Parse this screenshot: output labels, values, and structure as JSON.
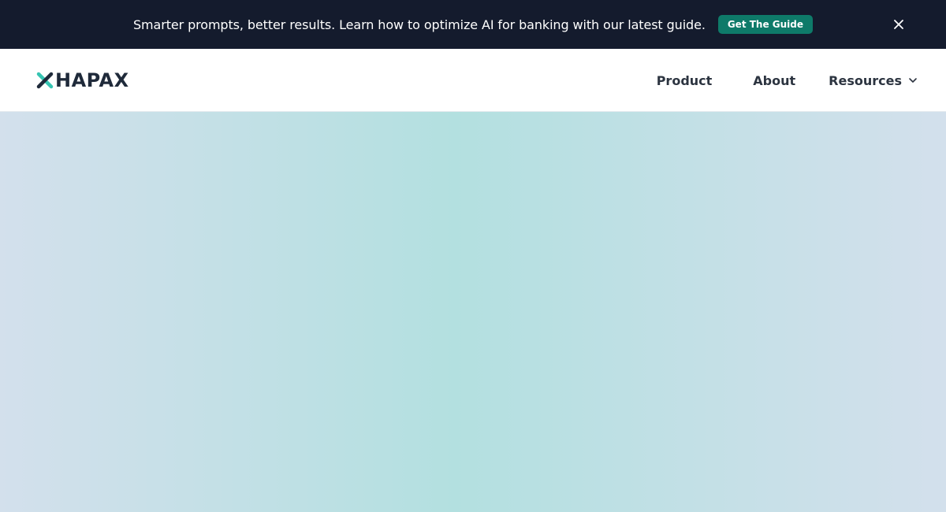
{
  "announcement": {
    "text": "Smarter prompts, better results. Learn how to optimize AI for banking with our latest guide.",
    "cta_label": "Get The Guide",
    "close_icon": "close-icon"
  },
  "navbar": {
    "logo_text": "HAPAX",
    "logo_icon": "hapax-logo-icon",
    "links": [
      {
        "label": "Product"
      },
      {
        "label": "About"
      },
      {
        "label": "Resources",
        "icon": "chevron-down-icon"
      }
    ]
  },
  "colors": {
    "banner_bg": "#141b2d",
    "banner_text": "#ffffff",
    "cta_bg": "#0e7a69",
    "cta_text": "#ffffff",
    "nav_text": "#2c3440",
    "logo_accent": "#36c4b2",
    "logo_dark": "#1f2a3a",
    "hero_edge": "#d3e0ec",
    "hero_center": "#b3e0e0"
  }
}
